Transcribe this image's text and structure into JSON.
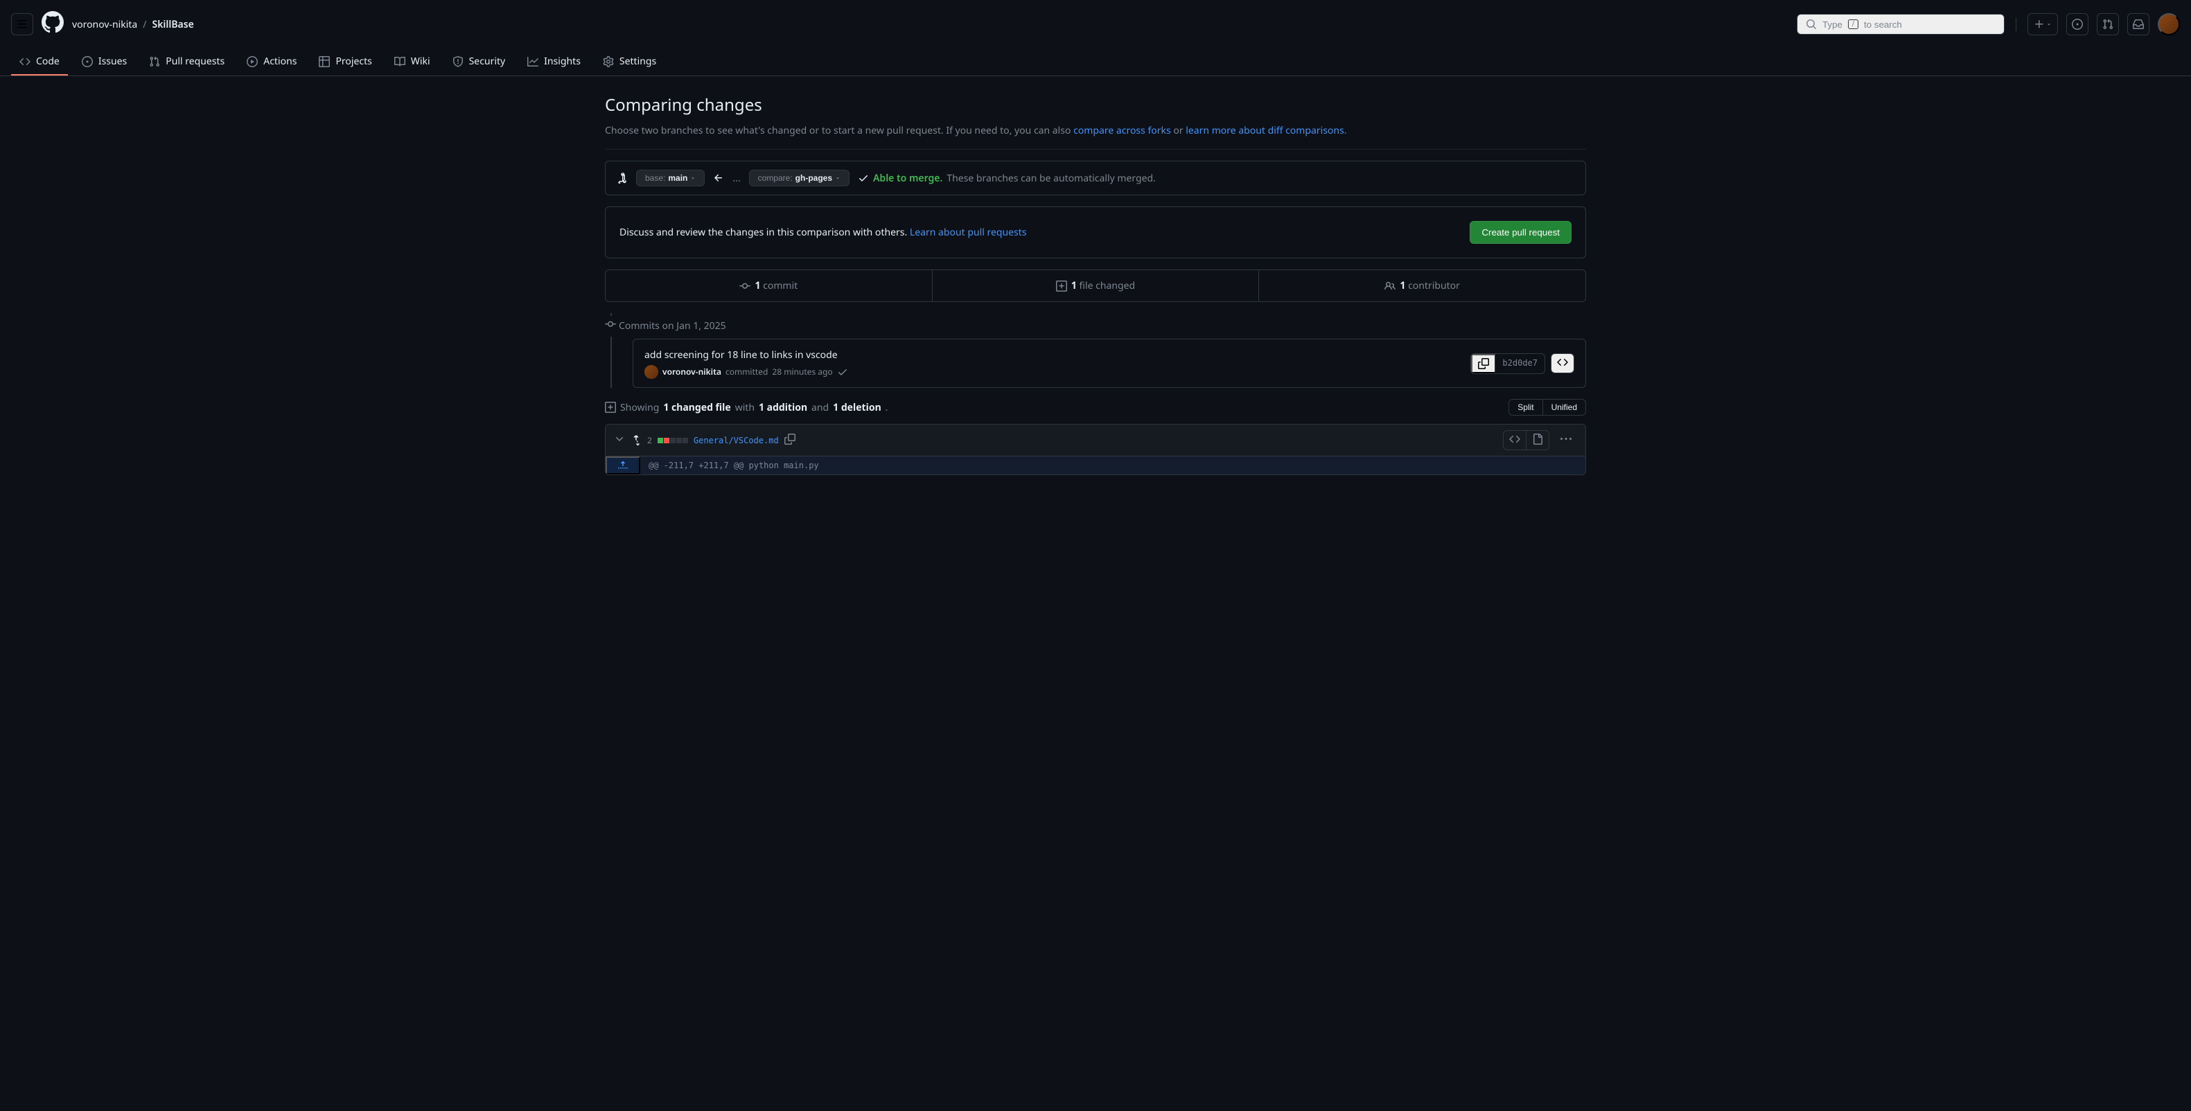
{
  "header": {
    "owner": "voronov-nikita",
    "repo": "SkillBase",
    "search_prefix": "Type",
    "search_slash": "/",
    "search_suffix": "to search"
  },
  "nav": {
    "code": "Code",
    "issues": "Issues",
    "pulls": "Pull requests",
    "actions": "Actions",
    "projects": "Projects",
    "wiki": "Wiki",
    "security": "Security",
    "insights": "Insights",
    "settings": "Settings"
  },
  "compare": {
    "title": "Comparing changes",
    "subtitle_pre": "Choose two branches to see what's changed or to start a new pull request. If you need to, you can also ",
    "link_forks": "compare across forks",
    "subtitle_or": " or ",
    "link_learn": "learn more about diff comparisons",
    "subtitle_end": ".",
    "base_label": "base: ",
    "base_branch": "main",
    "dots": "...",
    "compare_label": "compare: ",
    "compare_branch": "gh-pages",
    "able": "Able to merge.",
    "able_desc": "These branches can be automatically merged."
  },
  "discuss": {
    "text_pre": "Discuss and review the changes in this comparison with others. ",
    "link": "Learn about pull requests",
    "button": "Create pull request"
  },
  "stats": {
    "commits_n": "1",
    "commits_label": " commit",
    "files_n": "1",
    "files_label": " file changed",
    "contrib_n": "1",
    "contrib_label": " contributor"
  },
  "timeline": {
    "date": "Commits on Jan 1, 2025",
    "commit_title": "add screening for 18 line to links in vscode",
    "author": "voronov-nikita",
    "committed": " committed ",
    "time": "28 minutes ago",
    "sha": "b2d0de7"
  },
  "diff": {
    "showing": "Showing ",
    "changed_file": "1 changed file",
    "with": " with ",
    "addition": "1 addition",
    "and": " and ",
    "deletion": "1 deletion",
    "end": ".",
    "split": "Split",
    "unified": "Unified",
    "stat_count": "2",
    "filename": "General/VSCode.md",
    "hunk": "@@ -211,7 +211,7 @@ python main.py"
  }
}
